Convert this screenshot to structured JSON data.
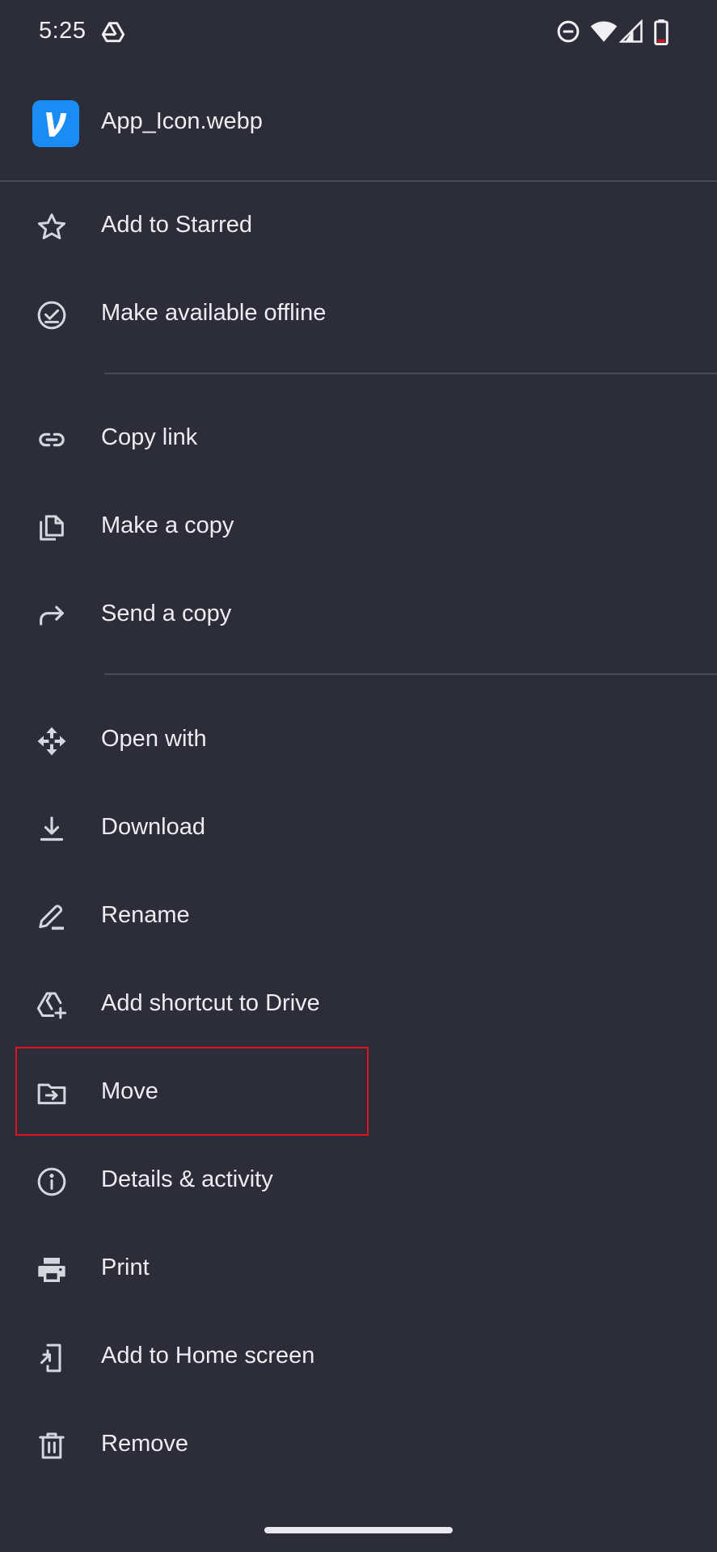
{
  "status_bar": {
    "time": "5:25",
    "icons": [
      "drive-notification-icon",
      "do-not-disturb-icon",
      "wifi-icon",
      "signal-icon",
      "battery-icon"
    ]
  },
  "header": {
    "file_name": "App_Icon.webp",
    "app_icon_letter": "V",
    "app_icon_color": "#1a8cf5"
  },
  "menu": {
    "items": [
      {
        "label": "Add to Starred",
        "icon": "star-icon"
      },
      {
        "label": "Make available offline",
        "icon": "offline-check-icon"
      },
      {
        "label": "Copy link",
        "icon": "link-icon"
      },
      {
        "label": "Make a copy",
        "icon": "copy-icon"
      },
      {
        "label": "Send a copy",
        "icon": "share-arrow-icon"
      },
      {
        "label": "Open with",
        "icon": "open-with-icon"
      },
      {
        "label": "Download",
        "icon": "download-icon"
      },
      {
        "label": "Rename",
        "icon": "rename-pencil-icon"
      },
      {
        "label": "Add shortcut to Drive",
        "icon": "drive-shortcut-icon"
      },
      {
        "label": "Move",
        "icon": "move-folder-icon"
      },
      {
        "label": "Details & activity",
        "icon": "info-icon"
      },
      {
        "label": "Print",
        "icon": "print-icon"
      },
      {
        "label": "Add to Home screen",
        "icon": "add-to-home-icon"
      },
      {
        "label": "Remove",
        "icon": "trash-icon"
      }
    ]
  },
  "colors": {
    "background": "#2d2d39",
    "highlight_border": "#e0141e"
  }
}
